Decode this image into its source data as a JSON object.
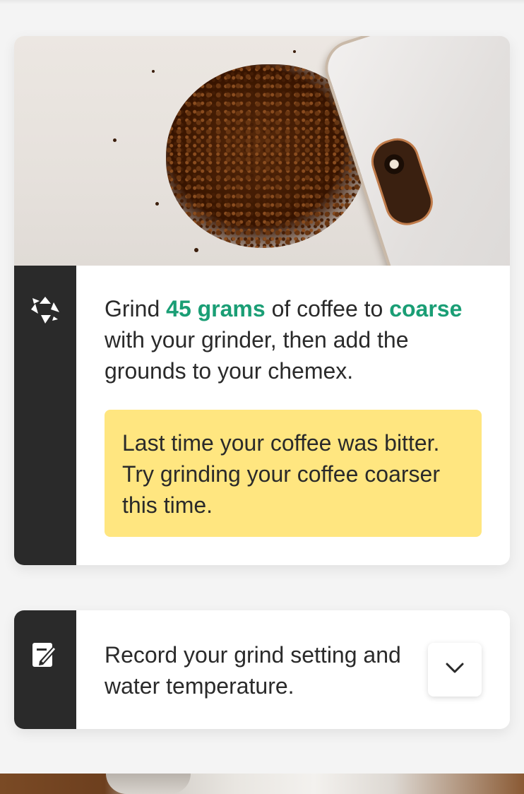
{
  "step_card": {
    "photo_icon": "coffee-grounds-photo",
    "icon": "grinder-icon",
    "instruction": {
      "part1": "Grind ",
      "amount": "45 grams",
      "part2": " of coffee to ",
      "grind_size": "coarse",
      "part3": " with your grinder, then add the grounds to your chemex."
    },
    "tip": "Last time your coffee was bitter. Try grinding your coffee coarser this time."
  },
  "record_card": {
    "icon": "note-edit-icon",
    "text": "Record your grind setting and water temperature.",
    "expand_icon": "chevron-down-icon"
  },
  "colors": {
    "highlight": "#1a9e75",
    "tip_background": "#ffe680",
    "sidebar": "#2a2a2a"
  }
}
